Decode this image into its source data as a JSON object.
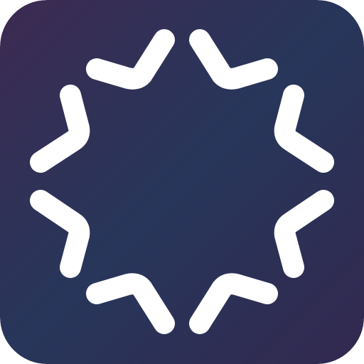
{
  "icon": {
    "name": "star-burst-app-icon",
    "colors": {
      "background_top_left": "#3d2a52",
      "background_center": "#27365a",
      "background_bottom_right": "#33284f",
      "glyph": "#ffffff"
    },
    "glyph": {
      "shape": "eight-point star outline",
      "segments": 8
    }
  }
}
